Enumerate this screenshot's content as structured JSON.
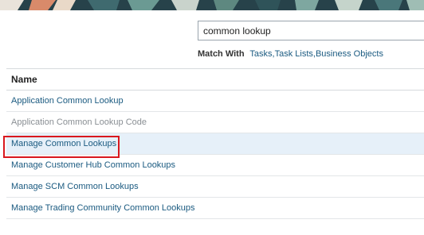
{
  "search": {
    "value": "common lookup"
  },
  "match_with": {
    "label": "Match With",
    "options": [
      "Tasks",
      "Task Lists",
      "Business Objects"
    ],
    "separator": ","
  },
  "results": {
    "column_header": "Name",
    "rows": [
      {
        "label": "Application Common Lookup",
        "disabled": false,
        "selected": false
      },
      {
        "label": "Application Common Lookup Code",
        "disabled": true,
        "selected": false
      },
      {
        "label": "Manage Common Lookups",
        "disabled": false,
        "selected": true
      },
      {
        "label": "Manage Customer Hub Common Lookups",
        "disabled": false,
        "selected": false
      },
      {
        "label": "Manage SCM Common Lookups",
        "disabled": false,
        "selected": false
      },
      {
        "label": "Manage Trading Community Common Lookups",
        "disabled": false,
        "selected": false
      }
    ]
  },
  "colors": {
    "link": "#1a5a80",
    "disabled_text": "#8a8f94",
    "selected_row": "#e6f0f9",
    "highlight_border": "#d9181e",
    "banner": "#27424a"
  }
}
